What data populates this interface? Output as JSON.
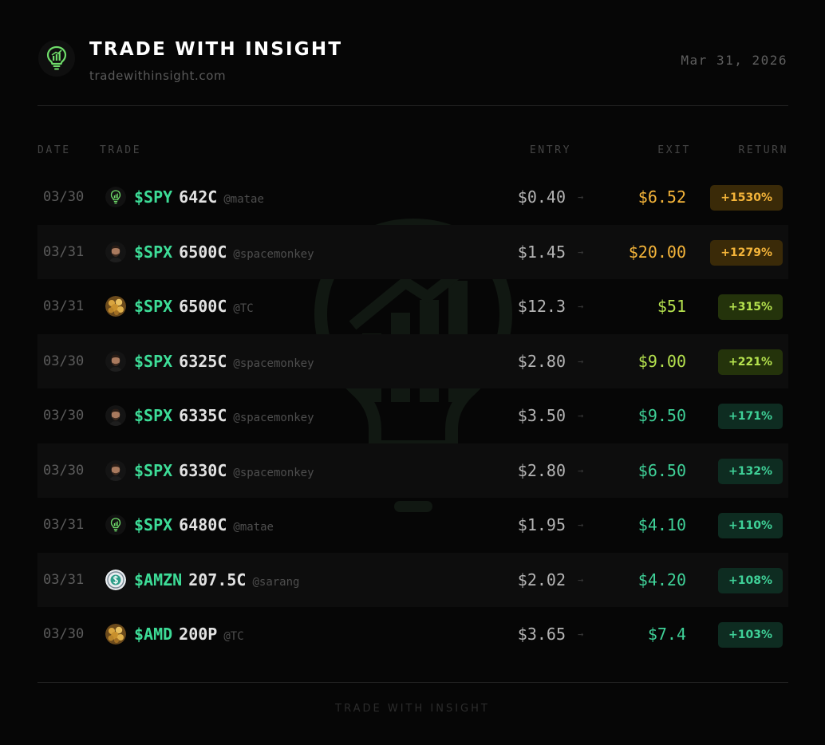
{
  "header": {
    "title": "TRADE WITH INSIGHT",
    "url": "tradewithinsight.com",
    "date": "Mar 31, 2026",
    "logo_icon": "lightbulb-chart-icon"
  },
  "columns": {
    "date": "DATE",
    "trade": "TRADE",
    "entry": "ENTRY",
    "exit": "EXIT",
    "return": "RETURN"
  },
  "colors": {
    "ticker": "#3ddc97",
    "gold": "#f5b53a",
    "lime": "#b5e24e",
    "green": "#3fd198"
  },
  "rows": [
    {
      "date": "03/30",
      "ticker": "$SPY",
      "strike": "642C",
      "handle": "@matae",
      "avatar": "bulb",
      "entry": "$0.40",
      "arrow": "→",
      "exit": "$6.52",
      "return": "+1530%",
      "tier": "gold"
    },
    {
      "date": "03/31",
      "ticker": "$SPX",
      "strike": "6500C",
      "handle": "@spacemonkey",
      "avatar": "person",
      "entry": "$1.45",
      "arrow": "→",
      "exit": "$20.00",
      "return": "+1279%",
      "tier": "gold"
    },
    {
      "date": "03/31",
      "ticker": "$SPX",
      "strike": "6500C",
      "handle": "@TC",
      "avatar": "gold",
      "entry": "$12.3",
      "arrow": "→",
      "exit": "$51",
      "return": "+315%",
      "tier": "lime"
    },
    {
      "date": "03/30",
      "ticker": "$SPX",
      "strike": "6325C",
      "handle": "@spacemonkey",
      "avatar": "person",
      "entry": "$2.80",
      "arrow": "→",
      "exit": "$9.00",
      "return": "+221%",
      "tier": "lime"
    },
    {
      "date": "03/30",
      "ticker": "$SPX",
      "strike": "6335C",
      "handle": "@spacemonkey",
      "avatar": "person",
      "entry": "$3.50",
      "arrow": "→",
      "exit": "$9.50",
      "return": "+171%",
      "tier": "green"
    },
    {
      "date": "03/30",
      "ticker": "$SPX",
      "strike": "6330C",
      "handle": "@spacemonkey",
      "avatar": "person",
      "entry": "$2.80",
      "arrow": "→",
      "exit": "$6.50",
      "return": "+132%",
      "tier": "green"
    },
    {
      "date": "03/31",
      "ticker": "$SPX",
      "strike": "6480C",
      "handle": "@matae",
      "avatar": "bulb",
      "entry": "$1.95",
      "arrow": "→",
      "exit": "$4.10",
      "return": "+110%",
      "tier": "green"
    },
    {
      "date": "03/31",
      "ticker": "$AMZN",
      "strike": "207.5C",
      "handle": "@sarang",
      "avatar": "coin",
      "entry": "$2.02",
      "arrow": "→",
      "exit": "$4.20",
      "return": "+108%",
      "tier": "green"
    },
    {
      "date": "03/30",
      "ticker": "$AMD",
      "strike": "200P",
      "handle": "@TC",
      "avatar": "gold",
      "entry": "$3.65",
      "arrow": "→",
      "exit": "$7.4",
      "return": "+103%",
      "tier": "green"
    }
  ],
  "footer": {
    "text": "TRADE WITH INSIGHT"
  }
}
